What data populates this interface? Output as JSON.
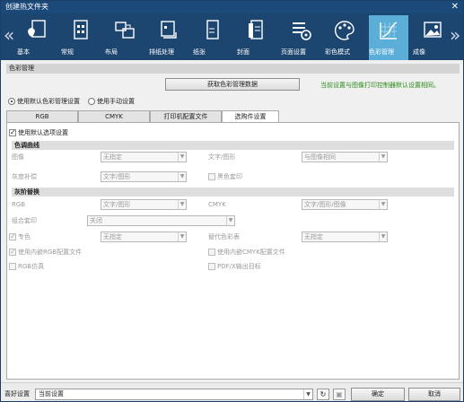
{
  "window": {
    "title": "创建热文件夹",
    "close_glyph": "✕"
  },
  "nav": {
    "left_arrow": "«",
    "right_arrow": "»",
    "tabs": [
      {
        "label": "基本",
        "icon": "basic-icon"
      },
      {
        "label": "常规",
        "icon": "general-icon"
      },
      {
        "label": "布局",
        "icon": "layout-icon"
      },
      {
        "label": "排纸处理",
        "icon": "output-tray-icon"
      },
      {
        "label": "纸张",
        "icon": "paper-icon"
      },
      {
        "label": "封面",
        "icon": "cover-icon"
      },
      {
        "label": "页面设置",
        "icon": "page-setup-icon"
      },
      {
        "label": "彩色模式",
        "icon": "color-mode-icon"
      },
      {
        "label": "色彩管理",
        "icon": "color-management-icon",
        "active": true
      },
      {
        "label": "成像",
        "icon": "imaging-icon"
      }
    ]
  },
  "color_mgmt": {
    "section_title": "色彩管理",
    "get_data_button": "获取色彩管理数据",
    "note": "当前设置与图像打印控制器默认设置相同。",
    "radio_default": "使用默认色彩管理设置",
    "radio_manual": "使用手动设置",
    "tabs": [
      "RGB",
      "CMYK",
      "打印机配置文件",
      "选购件设置"
    ],
    "use_default_option": "使用默认选项设置"
  },
  "tone_curve": {
    "title": "色调曲线",
    "image_label": "图像",
    "image_value": "无指定",
    "text_graphics_label": "文字/图形",
    "text_graphics_value": "与图像相同",
    "gray_comp_label": "灰度补偿",
    "gray_comp_value": "文字/图形",
    "black_overprint_label": "黑色套印"
  },
  "reverse": {
    "title": "灰阶替换",
    "rgb_label": "RGB",
    "rgb_value": "文字/图形",
    "cmyk_label": "CMYK",
    "cmyk_value": "文字/图形/图像"
  },
  "composite": {
    "label": "组合套印",
    "value": "关闭",
    "spot_label": "专色",
    "spot_value": "无指定",
    "alt_table_label": "替代色彩表",
    "alt_table_value": "无指定",
    "embedded_rgb": "使用内嵌RGB配置文件",
    "embedded_cmyk": "使用内嵌CMYK配置文件",
    "rgb_sim": "RGB仿真",
    "pdfx": "PDF/X输出目标"
  },
  "footer": {
    "favorites_label": "喜好设置",
    "favorites_value": "当前设置",
    "refresh_glyph": "↻",
    "save_glyph": "▣",
    "ok": "确定",
    "cancel": "取消"
  },
  "colors": {
    "title_bar": "#1b4a7a",
    "nav_bg": "#1c4570",
    "nav_active": "#5aaed8",
    "note_green": "#2b8a1b"
  }
}
